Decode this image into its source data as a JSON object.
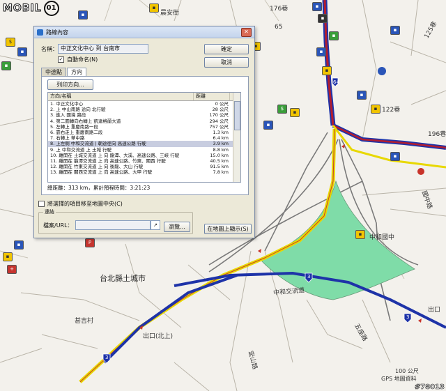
{
  "logo": {
    "text": "MOBIL",
    "ring": "01"
  },
  "watermark": "#78013",
  "map": {
    "labels": [
      {
        "text": "台北縣土城市",
        "big": true
      },
      {
        "text": "中和交流道",
        "big": false
      },
      {
        "text": "五座路",
        "big": false
      },
      {
        "text": "甚吉村",
        "big": false
      },
      {
        "text": "出口(北上)",
        "big": false
      },
      {
        "text": "晨安街",
        "big": false
      },
      {
        "text": "176巷",
        "big": false
      },
      {
        "text": "65",
        "big": false
      },
      {
        "text": "196巷",
        "big": false
      },
      {
        "text": "125巷",
        "big": false
      },
      {
        "text": "122巷",
        "big": false
      },
      {
        "text": "國中路",
        "big": false
      },
      {
        "text": "出口",
        "big": false
      },
      {
        "text": "宏山路",
        "big": false
      },
      {
        "text": "中和國中",
        "big": false
      },
      {
        "text": "100 公尺",
        "big": false
      },
      {
        "text": "GPS 地圖資料",
        "big": false
      }
    ],
    "shields": [
      "64",
      "3",
      "3",
      "3"
    ]
  },
  "dialog": {
    "title": "路線內容",
    "name_label": "名稱：",
    "name_value": "中正文化中心 到 台南市",
    "auto_name_label": "自動命名(N)",
    "auto_name_checked": true,
    "ok_button": "確定",
    "cancel_button": "取消",
    "tabs": [
      {
        "label": "中途點",
        "active": false
      },
      {
        "label": "方向",
        "active": true
      }
    ],
    "print_button": "列印方向...",
    "columns": [
      "方向/名稱",
      "距離"
    ],
    "rows": [
      {
        "text": "1.  中正文化中心",
        "dist": "0 公尺"
      },
      {
        "text": "2.  上 中山南路 途向 北行駛",
        "dist": "28 公尺"
      },
      {
        "text": "3.  進入 國境 路段",
        "dist": "170 公尺"
      },
      {
        "text": "4.  第二圓轉向右轉上 凱達格蘭大道",
        "dist": "294 公尺"
      },
      {
        "text": "5.  左轉上 重慶南路一段",
        "dist": "757 公尺"
      },
      {
        "text": "6.  靠右走上 重慶南路二段",
        "dist": "1.3 km"
      },
      {
        "text": "7.  右轉上 華中路",
        "dist": "6.4 km"
      },
      {
        "text": "8.  上左側 中和交流道 | 朝途徑向 高速公路 行駛",
        "dist": "3.9 km"
      },
      {
        "text": "9.  上 中和交流道 上 土城 行駛",
        "dist": "8.8 km"
      },
      {
        "text": "10.  離開在 土城交流道 上 向 龍潭、大溪、高速公路、三峽 行駛",
        "dist": "15.0 km"
      },
      {
        "text": "11.  離開在 龍潭交流道 上 向 高速公路、竹東、關西 行駛",
        "dist": "40.5 km"
      },
      {
        "text": "12.  離開在 竹東交流道 上 向 後龍、大山 行駛",
        "dist": "91.5 km"
      },
      {
        "text": "13.  離開在 關西交流道 上 向 高速公路、大甲 行駛",
        "dist": "7.8 km"
      }
    ],
    "selected_row": 7,
    "summary": "總距離：313 km，累計預程時間：3:21:23",
    "center_label": "將選擇的項目移至地圖中央(C)",
    "link_group": "連結",
    "file_label": "檔案/URL：",
    "file_value": "",
    "browse_button": "瀏覽...",
    "show_map_button": "在地圖上顯示(S)"
  }
}
